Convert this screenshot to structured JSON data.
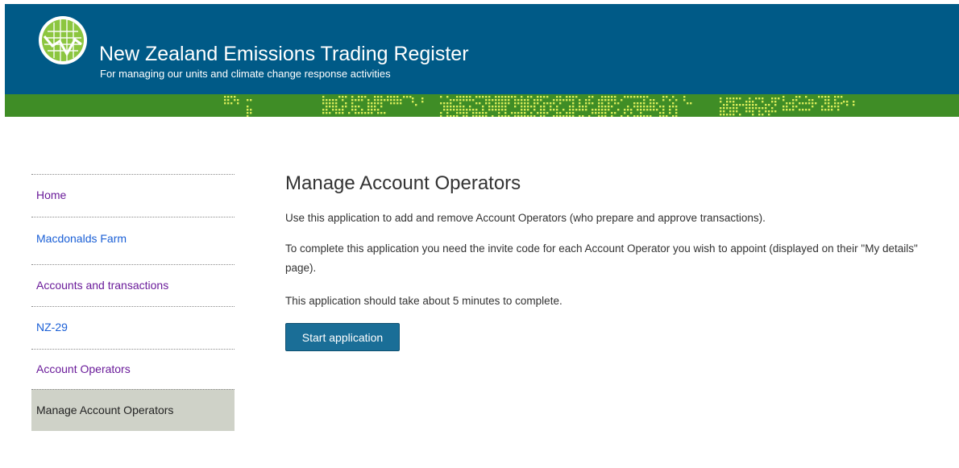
{
  "header": {
    "title": "New Zealand Emissions Trading Register",
    "subtitle": "For managing our units and climate change response activities",
    "colors": {
      "band": "#005a87",
      "green_strip": "#3f8d26",
      "dots": "#d9ec5a"
    },
    "logo_icon": "globe-chart-logo-icon"
  },
  "sidebar": {
    "items": [
      {
        "label": "Home",
        "state": "visited"
      },
      {
        "label": "Macdonalds Farm",
        "state": "link"
      },
      {
        "label": "Accounts and transactions",
        "state": "visited"
      },
      {
        "label": "NZ-29",
        "state": "link"
      },
      {
        "label": "Account Operators",
        "state": "visited"
      },
      {
        "label": "Manage Account Operators",
        "state": "current"
      }
    ]
  },
  "main": {
    "title": "Manage Account Operators",
    "intro": "Use this application to add and remove Account Operators (who prepare and approve transactions).",
    "requirement": "To complete this application you need the invite code for each Account Operator you wish to appoint (displayed on their \"My details\" page).",
    "duration": "This application should take about 5 minutes to complete.",
    "start_button": "Start application"
  }
}
